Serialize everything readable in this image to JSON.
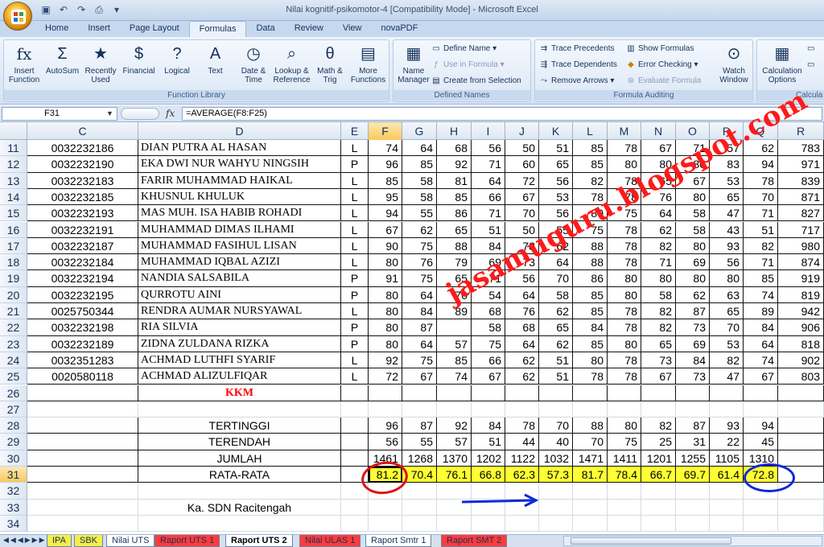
{
  "window": {
    "title": "Nilai kognitif-psikomotor-4  [Compatibility Mode] - Microsoft Excel"
  },
  "qat": [
    "save-icon",
    "undo-icon",
    "redo-icon",
    "print-icon",
    "dropdown-icon"
  ],
  "tabs": [
    "Home",
    "Insert",
    "Page Layout",
    "Formulas",
    "Data",
    "Review",
    "View",
    "novaPDF"
  ],
  "active_tab": "Formulas",
  "ribbon": {
    "function_library": {
      "label": "Function Library",
      "buttons": [
        {
          "label": "Insert Function",
          "icon": "fx"
        },
        {
          "label": "AutoSum",
          "icon": "Σ"
        },
        {
          "label": "Recently Used",
          "icon": "★"
        },
        {
          "label": "Financial",
          "icon": "$"
        },
        {
          "label": "Logical",
          "icon": "?"
        },
        {
          "label": "Text",
          "icon": "A"
        },
        {
          "label": "Date & Time",
          "icon": "◷"
        },
        {
          "label": "Lookup & Reference",
          "icon": "⌕"
        },
        {
          "label": "Math & Trig",
          "icon": "θ"
        },
        {
          "label": "More Functions",
          "icon": "▤"
        }
      ]
    },
    "defined_names": {
      "label": "Defined Names",
      "name_manager": "Name Manager",
      "define_name": "Define Name",
      "use_in_formula": "Use in Formula",
      "create_from_selection": "Create from Selection"
    },
    "formula_auditing": {
      "label": "Formula Auditing",
      "trace_precedents": "Trace Precedents",
      "trace_dependents": "Trace Dependents",
      "remove_arrows": "Remove Arrows",
      "show_formulas": "Show Formulas",
      "error_checking": "Error Checking",
      "evaluate_formula": "Evaluate Formula",
      "watch_window": "Watch Window"
    },
    "calculation": {
      "label": "Calcula",
      "calculation_options": "Calculation Options"
    }
  },
  "formula_bar": {
    "name_box": "F31",
    "fx": "fx",
    "formula": "=AVERAGE(F8:F25)"
  },
  "columns": [
    "C",
    "D",
    "E",
    "F",
    "G",
    "H",
    "I",
    "J",
    "K",
    "L",
    "M",
    "N",
    "O",
    "P",
    "Q",
    "R"
  ],
  "student_rows": [
    {
      "row": "11",
      "id": "0032232186",
      "name": "DIAN PUTRA AL HASAN",
      "sex": "L",
      "scores": [
        "74",
        "64",
        "68",
        "56",
        "50",
        "51",
        "85",
        "78",
        "67",
        "71",
        "57",
        "62"
      ],
      "r": "783"
    },
    {
      "row": "12",
      "id": "0032232190",
      "name": "EKA DWI NUR WAHYU NINGSIH",
      "sex": "P",
      "scores": [
        "96",
        "85",
        "92",
        "71",
        "60",
        "65",
        "85",
        "80",
        "80",
        "80",
        "83",
        "94"
      ],
      "r": "971"
    },
    {
      "row": "13",
      "id": "0032232183",
      "name": "FARIR MUHAMMAD HAIKAL",
      "sex": "L",
      "scores": [
        "85",
        "58",
        "81",
        "64",
        "72",
        "56",
        "82",
        "78",
        "65",
        "67",
        "53",
        "78"
      ],
      "r": "839"
    },
    {
      "row": "14",
      "id": "0032232185",
      "name": "KHUSNUL KHULUK",
      "sex": "L",
      "scores": [
        "95",
        "58",
        "85",
        "66",
        "67",
        "53",
        "78",
        "78",
        "76",
        "80",
        "65",
        "70"
      ],
      "r": "871"
    },
    {
      "row": "15",
      "id": "0032232193",
      "name": "MAS MUH. ISA HABIB ROHADI",
      "sex": "L",
      "scores": [
        "94",
        "55",
        "86",
        "71",
        "70",
        "56",
        "80",
        "75",
        "64",
        "58",
        "47",
        "71"
      ],
      "r": "827"
    },
    {
      "row": "16",
      "id": "0032232191",
      "name": "MUHAMMAD DIMAS ILHAMI",
      "sex": "L",
      "scores": [
        "67",
        "62",
        "65",
        "51",
        "50",
        "55",
        "75",
        "78",
        "62",
        "58",
        "43",
        "51"
      ],
      "r": "717"
    },
    {
      "row": "17",
      "id": "0032232187",
      "name": "MUHAMMAD FASIHUL LISAN",
      "sex": "L",
      "scores": [
        "90",
        "75",
        "88",
        "84",
        "78",
        "62",
        "88",
        "78",
        "82",
        "80",
        "93",
        "82"
      ],
      "r": "980"
    },
    {
      "row": "18",
      "id": "0032232184",
      "name": "MUHAMMAD IQBAL AZIZI",
      "sex": "L",
      "scores": [
        "80",
        "76",
        "79",
        "69",
        "73",
        "64",
        "88",
        "78",
        "71",
        "69",
        "56",
        "71"
      ],
      "r": "874"
    },
    {
      "row": "19",
      "id": "0032232194",
      "name": "NANDIA SALSABILA",
      "sex": "P",
      "scores": [
        "91",
        "75",
        "65",
        "71",
        "56",
        "70",
        "86",
        "80",
        "80",
        "80",
        "80",
        "85"
      ],
      "r": "919"
    },
    {
      "row": "20",
      "id": "0032232195",
      "name": "QURROTU AINI",
      "sex": "P",
      "scores": [
        "80",
        "64",
        "70",
        "54",
        "64",
        "58",
        "85",
        "80",
        "58",
        "62",
        "63",
        "74"
      ],
      "r": "819"
    },
    {
      "row": "21",
      "id": "0025750344",
      "name": "RENDRA AUMAR NURSYAWAL",
      "sex": "L",
      "scores": [
        "80",
        "84",
        "89",
        "68",
        "76",
        "62",
        "85",
        "78",
        "82",
        "87",
        "65",
        "89"
      ],
      "r": "942"
    },
    {
      "row": "22",
      "id": "0032232198",
      "name": "RIA SILVIA",
      "sex": "P",
      "scores": [
        "80",
        "87",
        "",
        "58",
        "68",
        "65",
        "84",
        "78",
        "82",
        "73",
        "70",
        "84"
      ],
      "r": "906"
    },
    {
      "row": "23",
      "id": "0032232189",
      "name": "ZIDNA ZULDANA RIZKA",
      "sex": "P",
      "scores": [
        "80",
        "64",
        "57",
        "75",
        "64",
        "62",
        "85",
        "80",
        "65",
        "69",
        "53",
        "64"
      ],
      "r": "818"
    },
    {
      "row": "24",
      "id": "0032351283",
      "name": "ACHMAD LUTHFI SYARIF",
      "sex": "L",
      "scores": [
        "92",
        "75",
        "85",
        "66",
        "62",
        "51",
        "80",
        "78",
        "73",
        "84",
        "82",
        "74"
      ],
      "r": "902"
    },
    {
      "row": "25",
      "id": "0020580118",
      "name": "ACHMAD ALIZULFIQAR",
      "sex": "L",
      "scores": [
        "72",
        "67",
        "74",
        "67",
        "62",
        "51",
        "78",
        "78",
        "67",
        "73",
        "47",
        "67"
      ],
      "r": "803"
    }
  ],
  "kkm_row": {
    "row": "26",
    "label": "KKM"
  },
  "empty_row": {
    "row": "27"
  },
  "summary_rows": [
    {
      "row": "28",
      "label": "TERTINGGI",
      "values": [
        "96",
        "87",
        "92",
        "84",
        "78",
        "70",
        "88",
        "80",
        "82",
        "87",
        "93",
        "94"
      ],
      "r": ""
    },
    {
      "row": "29",
      "label": "TERENDAH",
      "values": [
        "56",
        "55",
        "57",
        "51",
        "44",
        "40",
        "70",
        "75",
        "25",
        "31",
        "22",
        "45"
      ],
      "r": ""
    },
    {
      "row": "30",
      "label": "JUMLAH",
      "values": [
        "1461",
        "1268",
        "1370",
        "1202",
        "1122",
        "1032",
        "1471",
        "1411",
        "1201",
        "1255",
        "1105",
        "1310"
      ],
      "r": ""
    },
    {
      "row": "31",
      "label": "RATA-RATA",
      "values": [
        "81.2",
        "70.4",
        "76.1",
        "66.8",
        "62.3",
        "57.3",
        "81.7",
        "78.4",
        "66.7",
        "69.7",
        "61.4",
        "72.8"
      ],
      "r": ""
    }
  ],
  "trailing_rows": [
    {
      "row": "32",
      "text": ""
    },
    {
      "row": "33",
      "text": "Ka. SDN Racitengah"
    },
    {
      "row": "34",
      "text": ""
    }
  ],
  "sheet_tabs": [
    "IPA",
    "SBK",
    "Nilai UTS",
    "Raport UTS 1",
    "Raport UTS 2",
    "Nilai ULAS 1",
    "Raport Smtr 1",
    "Raport SMT 2"
  ],
  "active_sheet": "Raport UTS 2",
  "watermark": "jasamuguru.blogspot.com",
  "colors": {
    "selection": "#ffff33",
    "kkm": "#ff0000",
    "accent": "#15315a"
  }
}
